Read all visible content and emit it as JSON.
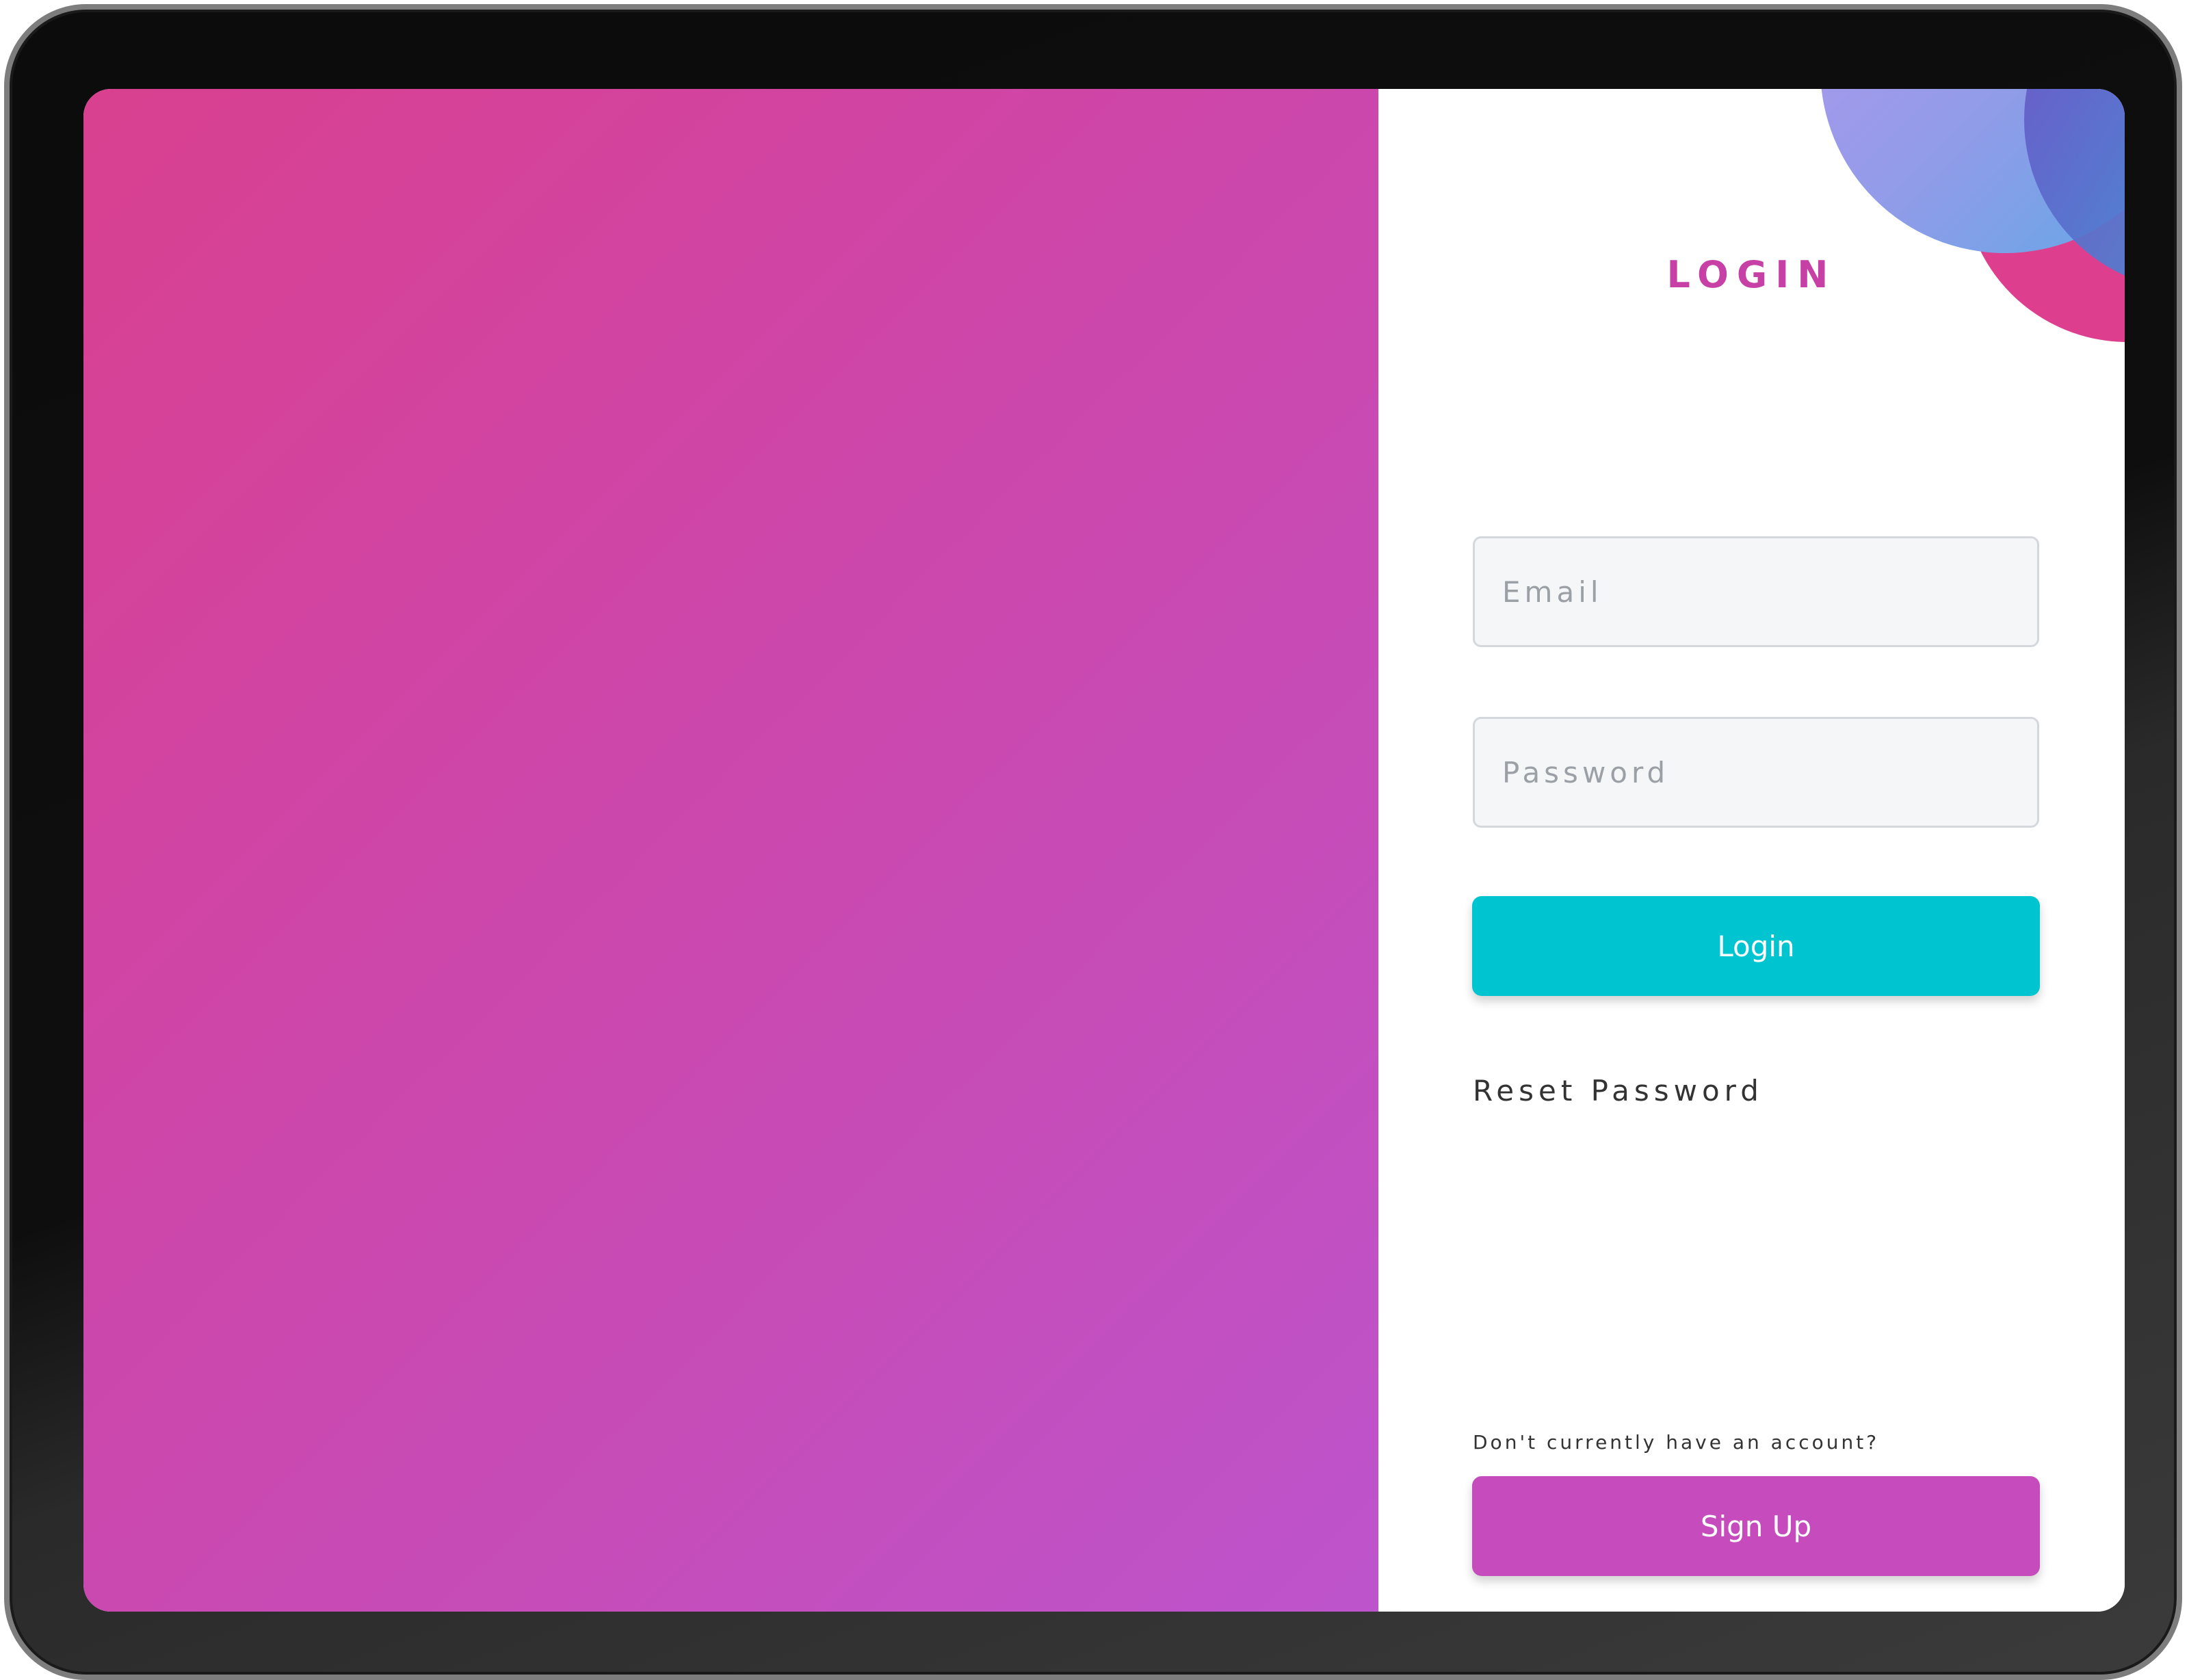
{
  "login_panel": {
    "title": "LOGIN",
    "email_placeholder": "Email",
    "email_value": "",
    "password_placeholder": "Password",
    "password_value": "",
    "login_button_label": "Login",
    "reset_link_label": "Reset Password",
    "no_account_text": "Don't currently have an account?",
    "signup_button_label": "Sign Up"
  },
  "colors": {
    "title": "#c640a5",
    "login_button": "#00c5d0",
    "signup_button": "#c64bbd",
    "hero_gradient_start": "#d9408f",
    "hero_gradient_end": "#bd54cc"
  }
}
